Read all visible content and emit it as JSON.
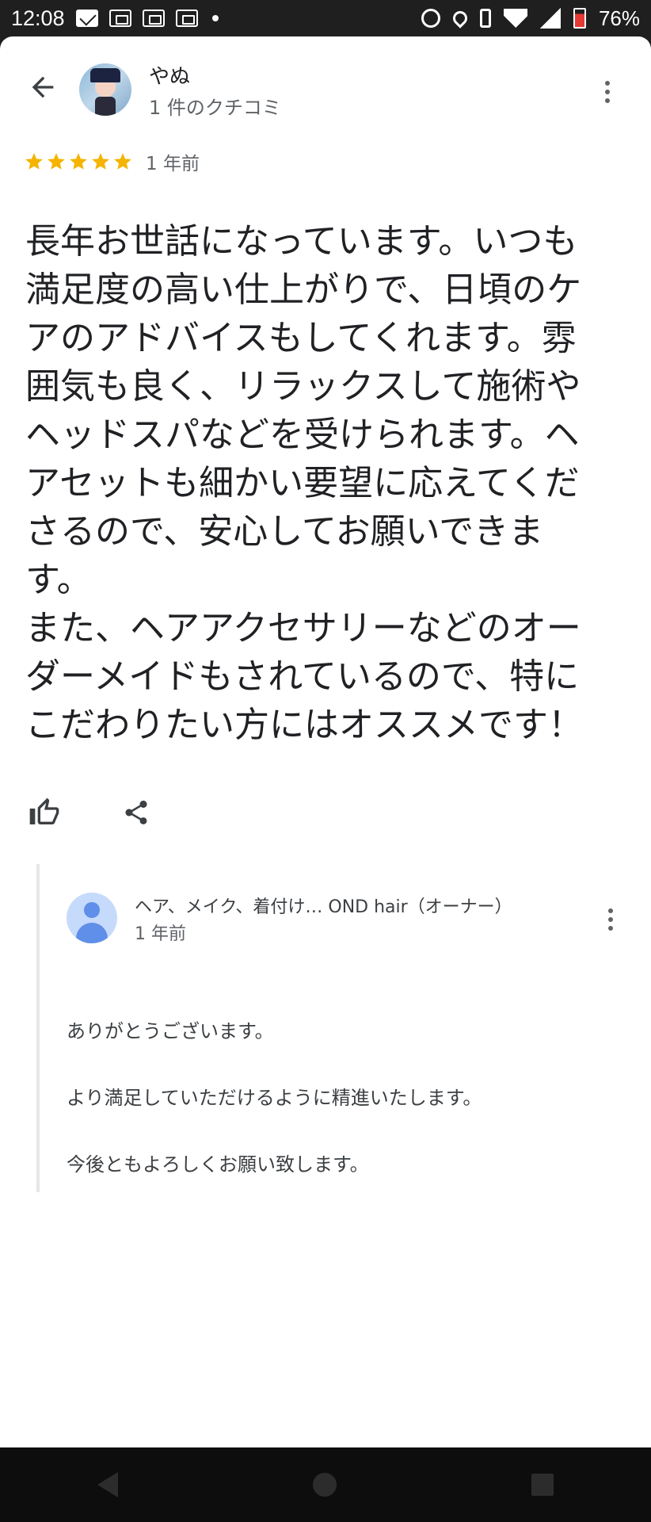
{
  "status_bar": {
    "time": "12:08",
    "battery": "76%",
    "battery_level": 0.76,
    "notification_icons": [
      "mail-icon",
      "carrier-icon",
      "carrier-icon",
      "carrier-icon"
    ],
    "system_icons": [
      "alarm-icon",
      "location-icon",
      "vibrate-icon",
      "wifi-icon",
      "signal-icon",
      "battery-icon"
    ]
  },
  "header": {
    "reviewer_name": "やぬ",
    "reviewer_review_count": "1 件のクチコミ"
  },
  "review": {
    "rating": 5,
    "time": "1 年前",
    "text": "長年お世話になっています。いつも満足度の高い仕上がりで、日頃のケアのアドバイスもしてくれます。雰囲気も良く、リラックスして施術やヘッドスパなどを受けられます。ヘアセットも細かい要望に応えてくださるので、安心してお願いできます。\nまた、ヘアアクセサリーなどのオーダーメイドもされているので、特にこだわりたい方にはオススメです！"
  },
  "owner_reply": {
    "name": "ヘア、メイク、着付け… OND hair（オーナー）",
    "time": "1 年前",
    "text": "ありがとうございます。\n\nより満足していただけるように精進いたします。\n\n今後ともよろしくお願い致します。"
  },
  "colors": {
    "star": "#f4b400",
    "icon": "#5f6368",
    "text": "#202124",
    "battery_low": "#e53935"
  }
}
